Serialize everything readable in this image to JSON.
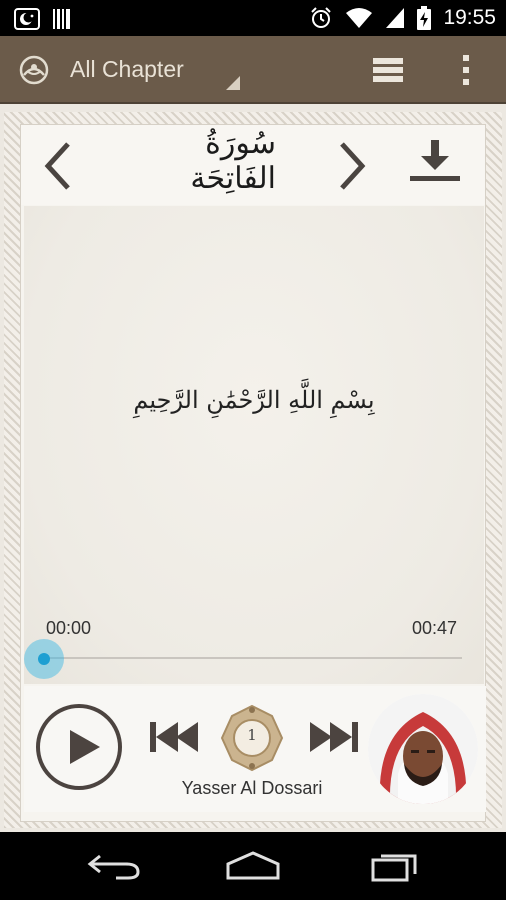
{
  "status_bar": {
    "time": "19:55",
    "icons": [
      "notification-crescent-icon",
      "barcode-icon",
      "alarm-icon",
      "wifi-icon",
      "signal-icon",
      "battery-charging-icon"
    ]
  },
  "action_bar": {
    "chapter_spinner_label": "All Chapter",
    "background_color": "#6b5b4a",
    "icons": [
      "app-logo-icon",
      "list-icon",
      "overflow-menu-icon"
    ]
  },
  "surah": {
    "title": "سُورَةُ الفَاتِحَة"
  },
  "verse": {
    "text": "بِسْمِ اللَّهِ الرَّحْمَٰنِ الرَّحِيمِ",
    "number": "1"
  },
  "player": {
    "current_time": "00:00",
    "total_time": "00:47",
    "progress_fraction": 0.0,
    "reciter_name": "Yasser Al Dossari",
    "accent_color": "#33b5e5"
  },
  "nav_bar": {
    "icons": [
      "back-icon",
      "home-icon",
      "recents-icon"
    ]
  }
}
